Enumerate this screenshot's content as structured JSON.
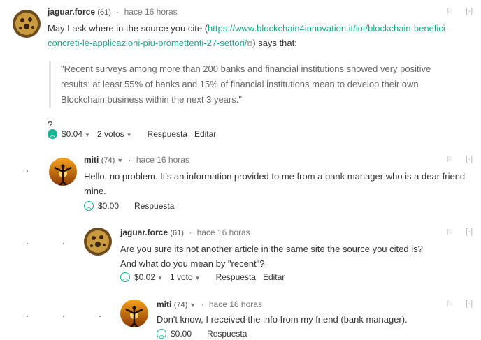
{
  "comments": [
    {
      "user": "jaguar.force",
      "rep": "(61)",
      "time": "hace 16 horas",
      "body_pre": "May I ask where in the source you cite (",
      "link": "https://www.blockchain4innovation.it/iot/blockchain-benefici-concreti-le-applicazioni-piu-promettenti-27-settori/",
      "body_post": ") says that:",
      "quote": "\"Recent surveys among more than 200 banks and financial institutions showed very positive results: at least 55% of banks and 15% of financial institutions mean to develop their own Blockchain business within the next 3 years.\"",
      "tail": "?",
      "payout": "$0.04",
      "votes": "2 votos",
      "reply": "Respuesta",
      "edit": "Editar"
    },
    {
      "user": "miti",
      "rep": "(74)",
      "time": "hace 16 horas",
      "body": "Hello, no problem. It's an information provided to me from a bank manager who is a dear friend mine.",
      "payout": "$0.00",
      "reply": "Respuesta"
    },
    {
      "user": "jaguar.force",
      "rep": "(61)",
      "time": "hace 16 horas",
      "body_line1": "Are you sure its not another article in the same site the source you cited is?",
      "body_line2": "And what do you mean by \"recent\"?",
      "payout": "$0.02",
      "votes": "1 voto",
      "reply": "Respuesta",
      "edit": "Editar"
    },
    {
      "user": "miti",
      "rep": "(74)",
      "time": "hace 16 horas",
      "body": "Don't know, I received the info from my friend (bank manager).",
      "payout": "$0.00",
      "reply": "Respuesta"
    }
  ],
  "ui": {
    "flag_icon": "flag-icon",
    "collapse": "[-]",
    "upvote_icon": "chevron-up-circle-icon",
    "colors": {
      "accent": "#1ab394",
      "link": "#1aaa8a"
    }
  }
}
